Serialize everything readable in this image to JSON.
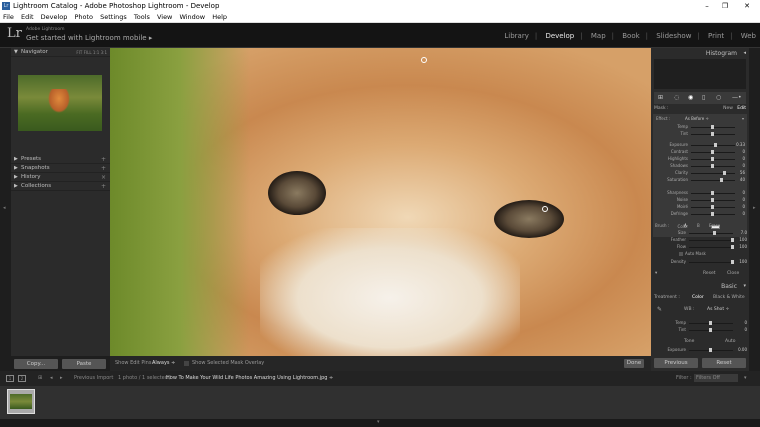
{
  "window": {
    "title": "Lightroom Catalog - Adobe Photoshop Lightroom - Develop",
    "app_icon": "Lr"
  },
  "menu": [
    "File",
    "Edit",
    "Develop",
    "Photo",
    "Settings",
    "Tools",
    "View",
    "Window",
    "Help"
  ],
  "identity": {
    "logo": "Lr",
    "line1": "Adobe Lightroom",
    "line2": "Get started with Lightroom mobile ▸"
  },
  "modules": [
    "Library",
    "Develop",
    "Map",
    "Book",
    "Slideshow",
    "Print",
    "Web"
  ],
  "active_module": "Develop",
  "left_panels": {
    "navigator": "Navigator",
    "navigator_opts": [
      "FIT",
      "FILL",
      "1:1",
      "3:1"
    ],
    "sections": [
      "Presets",
      "Snapshots",
      "History",
      "Collections"
    ]
  },
  "left_buttons": {
    "copy": "Copy...",
    "paste": "Paste"
  },
  "toolbar": {
    "show_edit_pins_label": "Show Edit Pins :",
    "show_edit_pins_value": "Always ÷",
    "overlay_label": "Show Selected Mask Overlay",
    "done": "Done"
  },
  "right": {
    "histogram": "Histogram",
    "mask_label": "Mask :",
    "mask_new": "New",
    "mask_edit": "Edit",
    "effect_label": "Effect :",
    "effect_value": "As Before ÷",
    "sliders": [
      {
        "label": "Temp",
        "value": ""
      },
      {
        "label": "Tint",
        "value": ""
      },
      {
        "label": "Exposure",
        "value": "0.33"
      },
      {
        "label": "Contrast",
        "value": "0"
      },
      {
        "label": "Highlights",
        "value": "0"
      },
      {
        "label": "Shadows",
        "value": "0"
      },
      {
        "label": "Clarity",
        "value": "56"
      },
      {
        "label": "Saturation",
        "value": "40"
      },
      {
        "label": "Sharpness",
        "value": "0"
      },
      {
        "label": "Noise",
        "value": "0"
      },
      {
        "label": "Moiré",
        "value": "0"
      },
      {
        "label": "Defringe",
        "value": "0"
      }
    ],
    "color_label": "Color",
    "brush_label": "Brush :",
    "brush_a": "A",
    "brush_b": "B",
    "brush_erase": "Erase",
    "brush_rows": [
      {
        "label": "Size",
        "value": "7.0"
      },
      {
        "label": "Feather",
        "value": "100"
      },
      {
        "label": "Flow",
        "value": "100"
      },
      {
        "label": "Density",
        "value": "100"
      }
    ],
    "auto_mask": "Auto Mask",
    "reset": "Reset",
    "close": "Close",
    "basic": "Basic",
    "treatment_label": "Treatment :",
    "treatment_color": "Color",
    "treatment_bw": "Black & White",
    "wb_label": "WB :",
    "wb_value": "As Shot ÷",
    "basic_sliders": [
      {
        "label": "Temp",
        "value": "0"
      },
      {
        "label": "Tint",
        "value": "0"
      }
    ],
    "tone": "Tone",
    "tone_auto": "Auto",
    "exposure": {
      "label": "Exposure",
      "value": "0.00"
    },
    "previous": "Previous",
    "reset_btn": "Reset"
  },
  "filmbar": {
    "nav_numbers": [
      "1",
      "2"
    ],
    "prev_import": "Previous Import",
    "count": "1 photo / 1 selected /",
    "filename": "How To Make Your Wild Life Photos Amazing Using Lightroom.jpg ÷",
    "filter_label": "Filter :",
    "filter_value": "Filters Off"
  }
}
